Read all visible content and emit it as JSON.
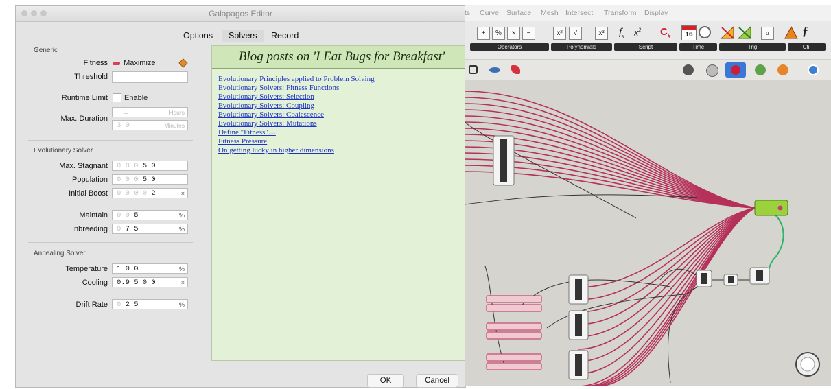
{
  "editor": {
    "title": "Galapagos Editor",
    "tabs": [
      "Options",
      "Solvers",
      "Record"
    ],
    "selected_tab": "Solvers",
    "generic": {
      "heading": "Generic",
      "fitness_label": "Fitness",
      "fitness_value": "Maximize",
      "threshold_label": "Threshold",
      "threshold_value": "",
      "runtime_label": "Runtime Limit",
      "runtime_toggle": "Enable",
      "runtime_checked": false,
      "duration_label": "Max. Duration",
      "duration_hours_value": "1",
      "duration_hours_unit": "Hours",
      "duration_minutes_value": "3 0",
      "duration_minutes_unit": "Minutes"
    },
    "evolutionary": {
      "heading": "Evolutionary Solver",
      "max_stagnant_label": "Max. Stagnant",
      "max_stagnant_value": "5 0",
      "population_label": "Population",
      "population_value": "5 0",
      "initial_boost_label": "Initial Boost",
      "initial_boost_value": "2",
      "initial_boost_unit": "×",
      "maintain_label": "Maintain",
      "maintain_value": "5",
      "maintain_unit": "%",
      "inbreeding_label": "Inbreeding",
      "inbreeding_value": "7 5",
      "inbreeding_unit": "%"
    },
    "annealing": {
      "heading": "Annealing Solver",
      "temperature_label": "Temperature",
      "temperature_value": "1 0 0",
      "temperature_unit": "%",
      "cooling_label": "Cooling",
      "cooling_value": "0.9 5 0 0",
      "cooling_unit": "×",
      "drift_label": "Drift Rate",
      "drift_value": "2 5",
      "drift_unit": "%"
    },
    "blog": {
      "title": "Blog posts on 'I Eat Bugs for Breakfast'",
      "links": [
        "Evolutionary Principles applied to Problem Solving",
        "Evolutionary Solvers: Fitness Functions",
        "Evolutionary Solvers: Selection",
        "Evolutionary Solvers: Coupling",
        "Evolutionary Solvers: Coalescence",
        "Evolutionary Solvers: Mutations",
        "Define \"Fitness\"....",
        "Fitness Pressure",
        "On getting lucky in higher dimensions"
      ]
    },
    "ok_label": "OK",
    "cancel_label": "Cancel"
  },
  "grasshopper": {
    "menu": [
      "ts",
      "Curve",
      "Surface",
      "Mesh",
      "Intersect",
      "Transform",
      "Display"
    ],
    "toolbar_groups": [
      "Operators",
      "Polynomials",
      "Script",
      "Time",
      "Trig",
      "Util"
    ],
    "calendar_text": "16",
    "colors": {
      "wire": "#b5305a",
      "selected_wire": "#2db36b",
      "selected_node": "#9bd13c"
    }
  }
}
